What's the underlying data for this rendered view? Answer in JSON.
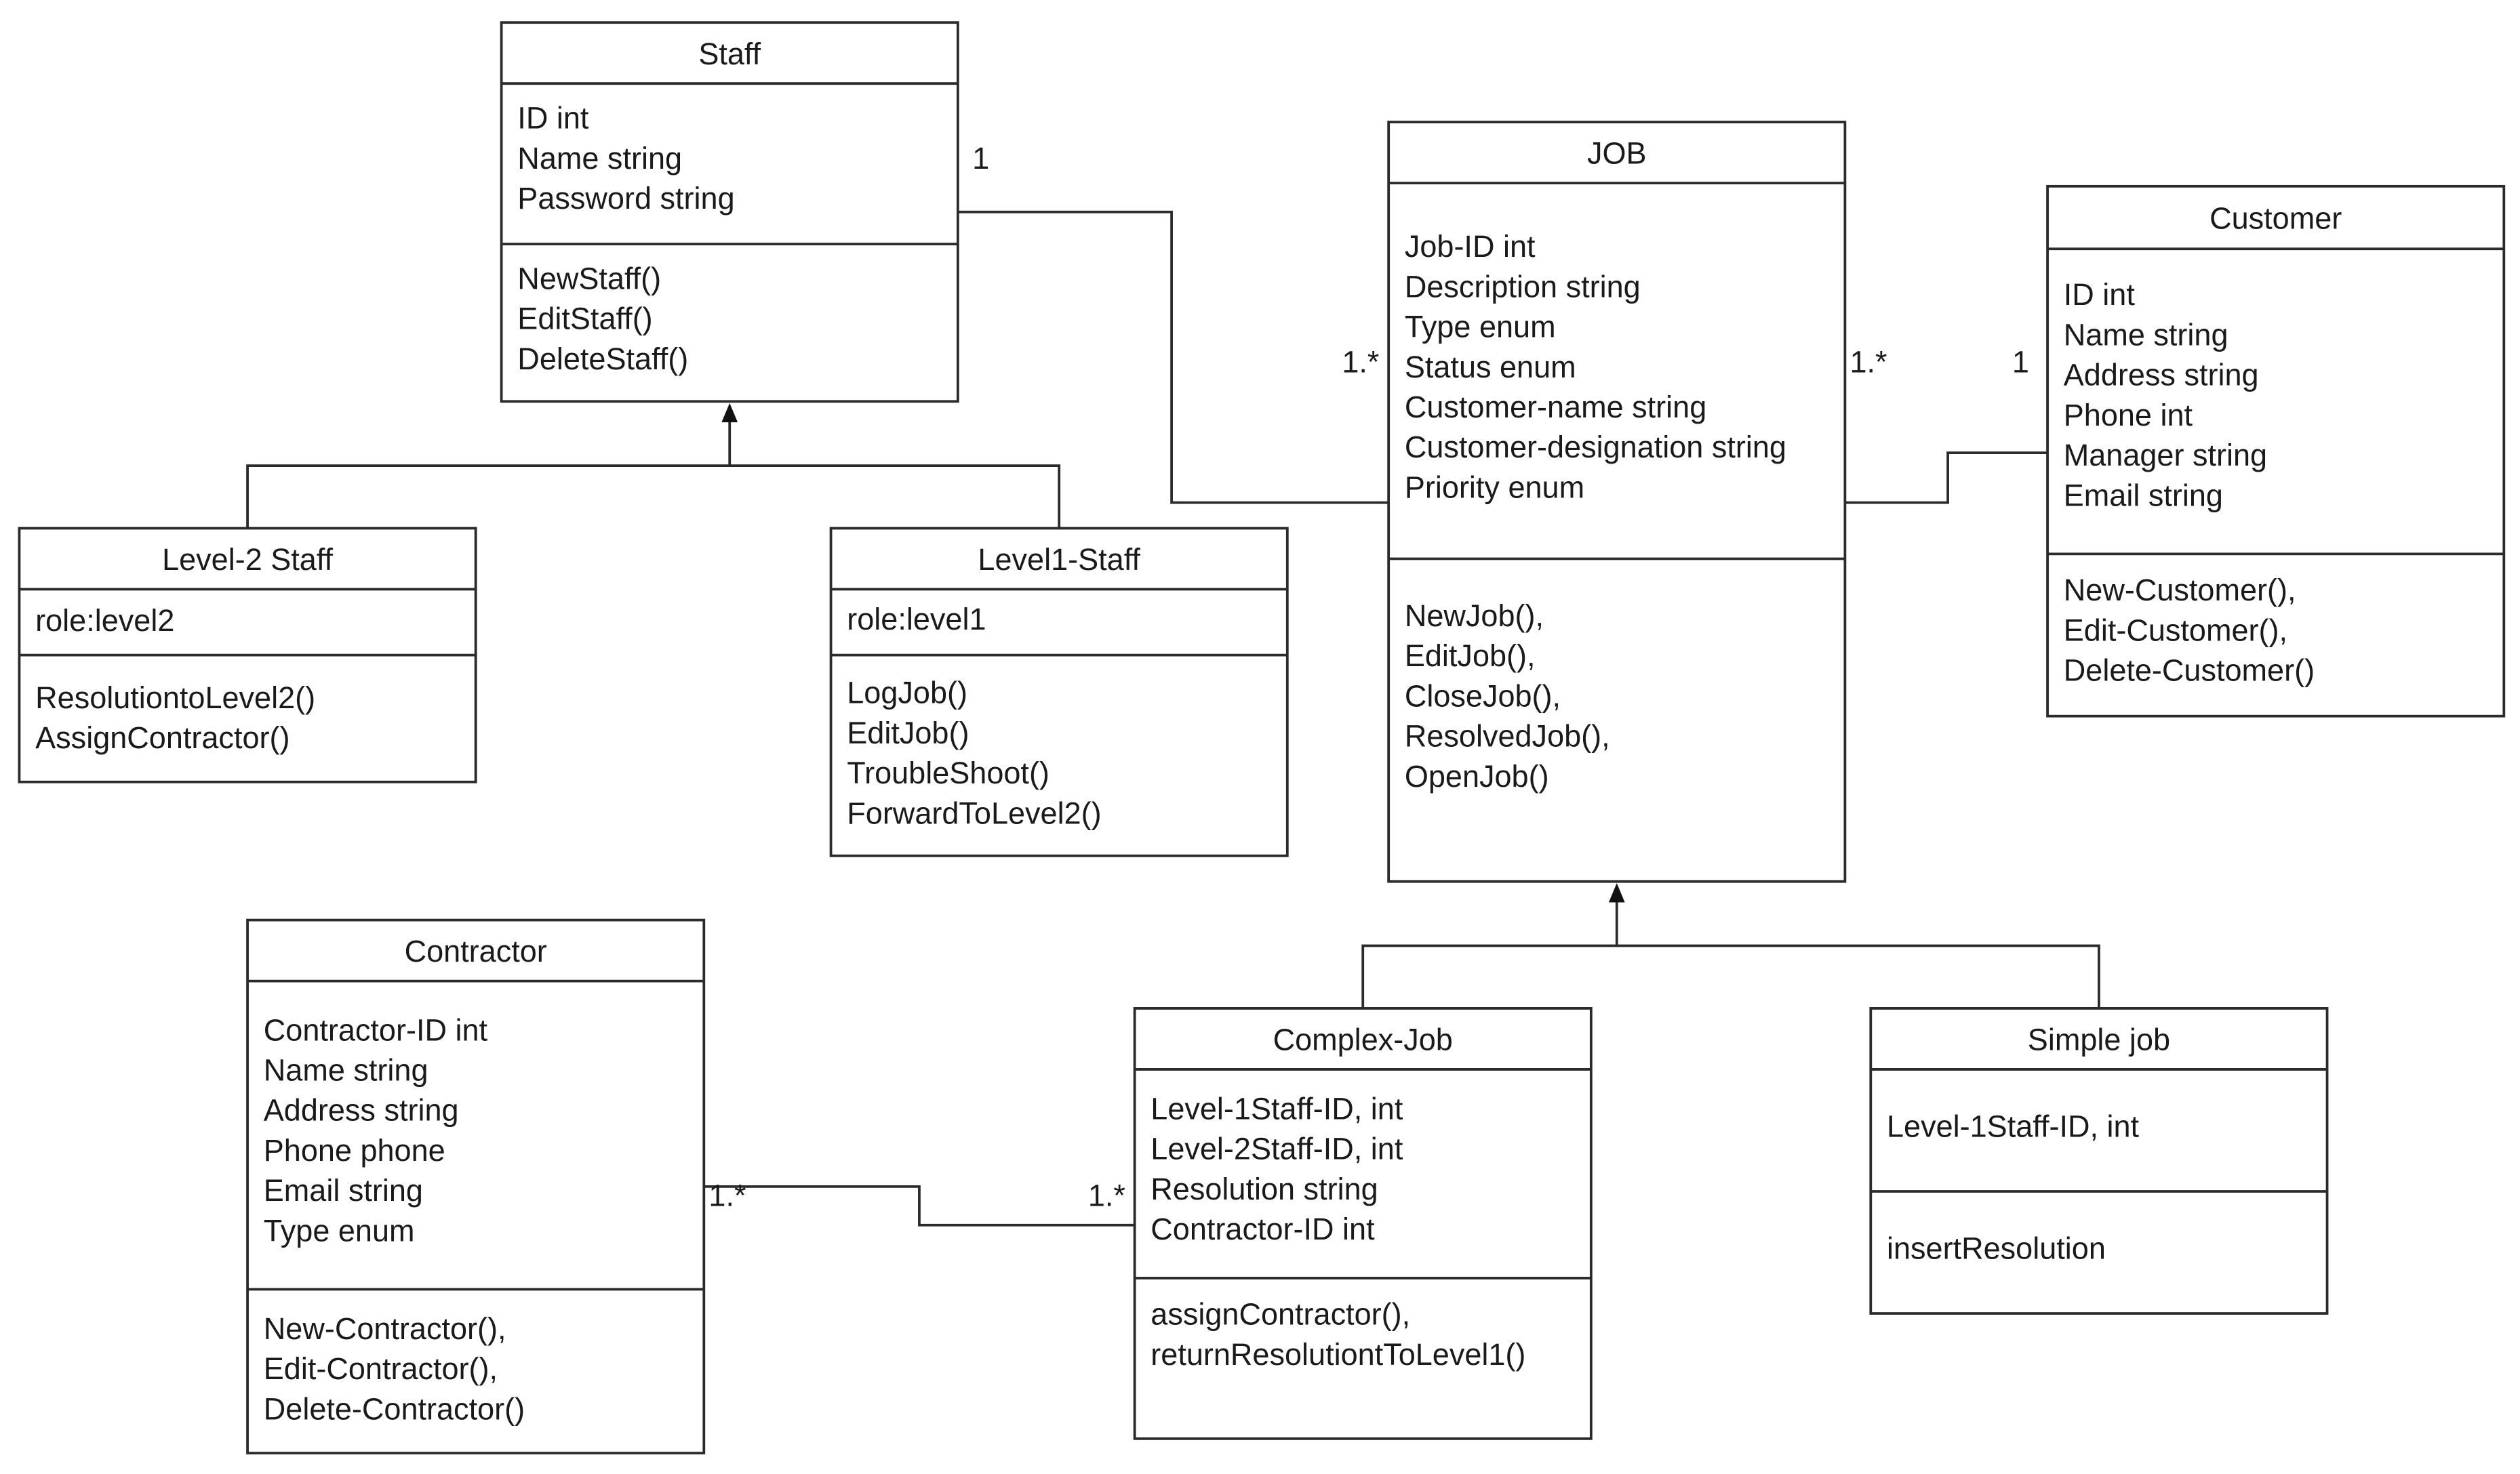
{
  "diagram": {
    "type": "UML class diagram",
    "classes": {
      "staff": {
        "name": "Staff",
        "attributes": [
          "ID int",
          "Name string",
          "Password string"
        ],
        "methods": [
          "NewStaff()",
          "EditStaff()",
          "DeleteStaff()"
        ]
      },
      "level2_staff": {
        "name": "Level-2 Staff",
        "attributes": [
          "role:level2"
        ],
        "methods": [
          "ResolutiontoLevel2()",
          "AssignContractor()"
        ]
      },
      "level1_staff": {
        "name": "Level1-Staff",
        "attributes": [
          "role:level1"
        ],
        "methods": [
          "LogJob()",
          "EditJob()",
          "TroubleShoot()",
          "ForwardToLevel2()"
        ]
      },
      "job": {
        "name": "JOB",
        "attributes": [
          "Job-ID int",
          "Description string",
          "Type enum",
          "Status enum",
          "Customer-name string",
          "Customer-designation string",
          "Priority enum"
        ],
        "methods": [
          "NewJob(),",
          "EditJob(),",
          "CloseJob(),",
          "ResolvedJob(),",
          "OpenJob()"
        ]
      },
      "customer": {
        "name": "Customer",
        "attributes": [
          "ID int",
          "Name string",
          "Address string",
          "Phone int",
          "Manager string",
          "Email string"
        ],
        "methods": [
          " New-Customer(),",
          "Edit-Customer(),",
          "Delete-Customer()"
        ]
      },
      "contractor": {
        "name": "Contractor",
        "attributes": [
          "Contractor-ID int",
          "Name string",
          "Address string",
          "Phone phone",
          "Email string",
          "Type enum"
        ],
        "methods": [
          "New-Contractor(),",
          "Edit-Contractor(),",
          "Delete-Contractor()"
        ]
      },
      "complex_job": {
        "name": "Complex-Job",
        "attributes": [
          "Level-1Staff-ID, int",
          "Level-2Staff-ID, int",
          "Resolution string",
          "Contractor-ID int"
        ],
        "methods": [
          "assignContractor(),",
          "returnResolutiontToLevel1()"
        ]
      },
      "simple_job": {
        "name": "Simple job",
        "attributes": [
          "Level-1Staff-ID, int"
        ],
        "methods": [
          "insertResolution"
        ]
      }
    },
    "relationships": {
      "staff_job": {
        "type": "association",
        "from": "Staff",
        "to": "JOB",
        "from_mult": "1",
        "to_mult": "1.*"
      },
      "job_customer": {
        "type": "association",
        "from": "JOB",
        "to": "Customer",
        "from_mult": "1.*",
        "to_mult": "1"
      },
      "contractor_complexjob": {
        "type": "association",
        "from": "Contractor",
        "to": "Complex-Job",
        "from_mult": "1.*",
        "to_mult": "1.*"
      },
      "staff_generalization": {
        "type": "generalization",
        "parent": "Staff",
        "children": [
          "Level-2 Staff",
          "Level1-Staff"
        ]
      },
      "job_generalization": {
        "type": "generalization",
        "parent": "JOB",
        "children": [
          "Complex-Job",
          "Simple job"
        ]
      }
    }
  }
}
